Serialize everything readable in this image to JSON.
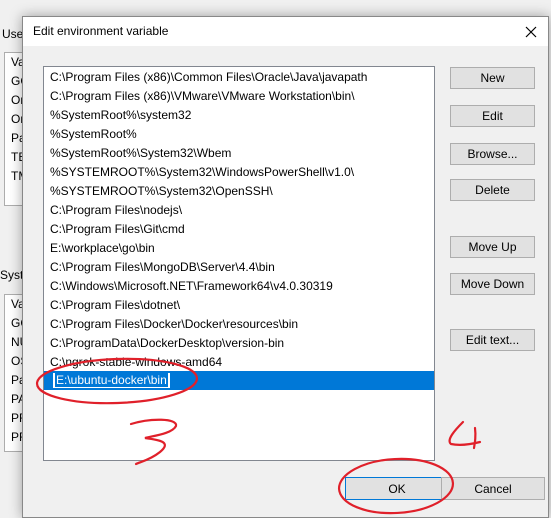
{
  "parent_window": {
    "user_vars_label": "User",
    "user_list": [
      "Va",
      "GC",
      "On",
      "On",
      "Pa",
      "TE",
      "TM"
    ],
    "system_vars_label": "Syste",
    "system_list": [
      "Va",
      "GC",
      "NU",
      "OS",
      "Pa",
      "PA",
      "PR",
      "PR"
    ]
  },
  "dialog": {
    "title": "Edit environment variable",
    "close_icon": "close-icon",
    "paths": [
      "C:\\Program Files (x86)\\Common Files\\Oracle\\Java\\javapath",
      "C:\\Program Files (x86)\\VMware\\VMware Workstation\\bin\\",
      "%SystemRoot%\\system32",
      "%SystemRoot%",
      "%SystemRoot%\\System32\\Wbem",
      "%SYSTEMROOT%\\System32\\WindowsPowerShell\\v1.0\\",
      "%SYSTEMROOT%\\System32\\OpenSSH\\",
      "C:\\Program Files\\nodejs\\",
      "C:\\Program Files\\Git\\cmd",
      "E:\\workplace\\go\\bin",
      "C:\\Program Files\\MongoDB\\Server\\4.4\\bin",
      "C:\\Windows\\Microsoft.NET\\Framework64\\v4.0.30319",
      "C:\\Program Files\\dotnet\\",
      "C:\\Program Files\\Docker\\Docker\\resources\\bin",
      "C:\\ProgramData\\DockerDesktop\\version-bin",
      "C:\\ngrok-stable-windows-amd64"
    ],
    "editing_value": "E:\\ubuntu-docker\\bin",
    "buttons": {
      "new": "New",
      "edit": "Edit",
      "browse": "Browse...",
      "delete": "Delete",
      "move_up": "Move Up",
      "move_down": "Move Down",
      "edit_text": "Edit text...",
      "ok": "OK",
      "cancel": "Cancel"
    }
  },
  "annotations": {
    "step_3": "3",
    "step_4": "4",
    "color": "#e0202a"
  }
}
